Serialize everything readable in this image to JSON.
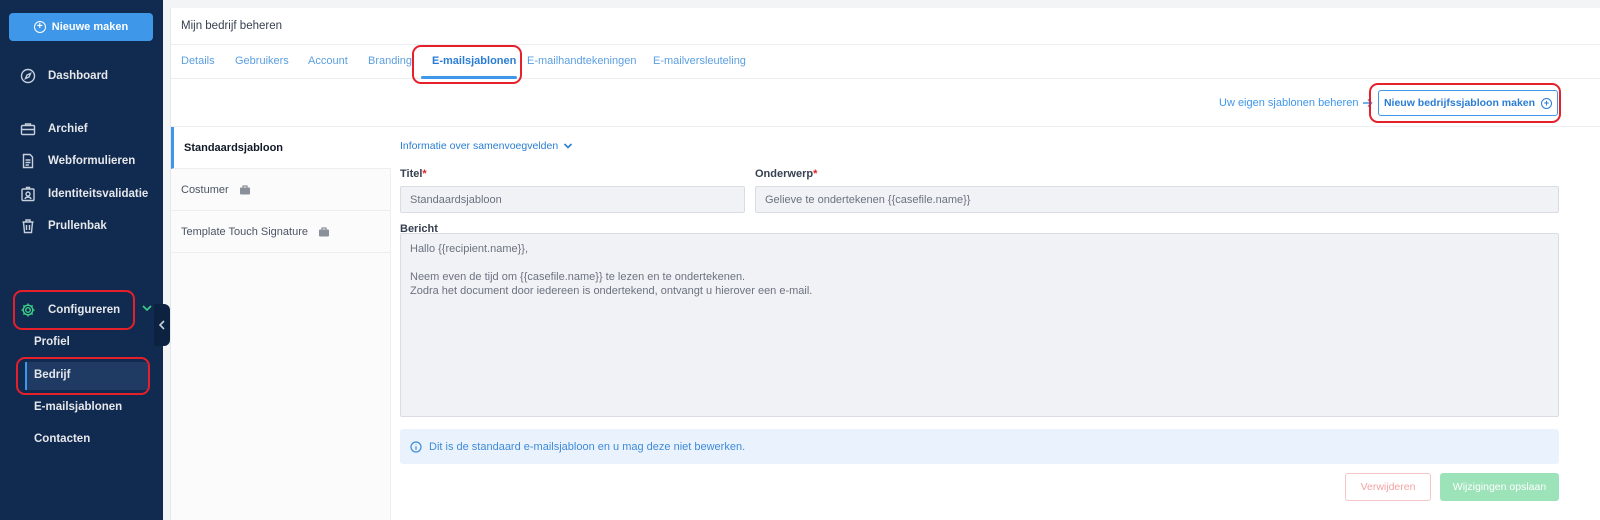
{
  "sidebar": {
    "new_button": "Nieuwe maken",
    "items": [
      {
        "label": "Dashboard",
        "icon": "compass-icon"
      },
      {
        "label": "Archief",
        "icon": "briefcase-icon"
      },
      {
        "label": "Webformulieren",
        "icon": "document-icon"
      },
      {
        "label": "Identiteitsvalidatie",
        "icon": "id-badge-icon"
      },
      {
        "label": "Prullenbak",
        "icon": "trash-icon"
      },
      {
        "label": "Configureren",
        "icon": "gear-icon"
      }
    ],
    "subitems": [
      "Profiel",
      "Bedrijf",
      "E-mailsjablonen",
      "Contacten"
    ],
    "active_subitem": "Bedrijf"
  },
  "header": {
    "title": "Mijn bedrijf beheren"
  },
  "tabs": [
    {
      "label": "Details"
    },
    {
      "label": "Gebruikers"
    },
    {
      "label": "Account"
    },
    {
      "label": "Branding"
    },
    {
      "label": "E-mailsjablonen",
      "active": true
    },
    {
      "label": "E-mailhandtekeningen"
    },
    {
      "label": "E-mailversleuteling"
    }
  ],
  "actions": {
    "manage_link": "Uw eigen sjablonen beheren",
    "new_template_button": "Nieuw bedrijfssjabloon maken"
  },
  "templates": [
    {
      "label": "Standaardsjabloon",
      "active": true
    },
    {
      "label": "Costumer",
      "icon": "briefcase-icon"
    },
    {
      "label": "Template Touch Signature",
      "icon": "briefcase-icon"
    }
  ],
  "form": {
    "info_link": "Informatie over samenvoegvelden",
    "title_label": "Titel",
    "title_value": "Standaardsjabloon",
    "subject_label": "Onderwerp",
    "subject_value": "Gelieve te ondertekenen {{casefile.name}}",
    "message_label": "Bericht",
    "message_lines": [
      "Hallo {{recipient.name}},",
      "",
      "Neem even de tijd om {{casefile.name}} te lezen en te ondertekenen.",
      "Zodra het document door iedereen is ondertekend, ontvangt u hierover een e-mail."
    ],
    "info_text": "Dit is de standaard e-mailsjabloon en u mag deze niet bewerken.",
    "delete_button": "Verwijderen",
    "save_button": "Wijzigingen opslaan"
  },
  "colors": {
    "sidebar_bg": "#112a4f",
    "accent": "#3f97ea",
    "highlight": "#e5202a",
    "save_disabled": "#9ce3b9"
  }
}
